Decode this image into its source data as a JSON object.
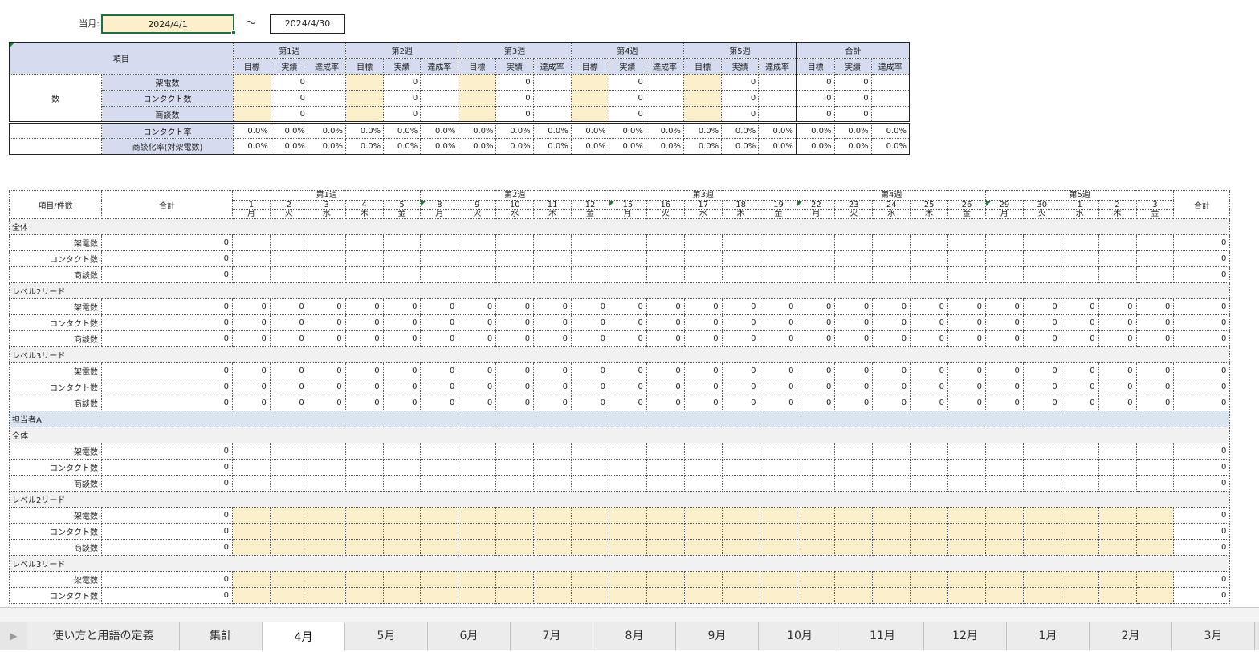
{
  "header": {
    "month_label": "当月:",
    "start_date": "2024/4/1",
    "tilde": "〜",
    "end_date": "2024/4/30"
  },
  "summary": {
    "item_header": "項目",
    "week_labels": [
      "第1週",
      "第2週",
      "第3週",
      "第4週",
      "第5週",
      "合計"
    ],
    "sub_labels": [
      "目標",
      "実績",
      "達成率"
    ],
    "group_label": "数",
    "rows": [
      {
        "label": "架電数",
        "values": [
          "",
          "0",
          "",
          "",
          "0",
          "",
          "",
          "0",
          "",
          "",
          "0",
          "",
          "",
          "0",
          "",
          "0",
          "0",
          ""
        ]
      },
      {
        "label": "コンタクト数",
        "values": [
          "",
          "0",
          "",
          "",
          "0",
          "",
          "",
          "0",
          "",
          "",
          "0",
          "",
          "",
          "0",
          "",
          "0",
          "0",
          ""
        ]
      },
      {
        "label": "商談数",
        "values": [
          "",
          "0",
          "",
          "",
          "0",
          "",
          "",
          "0",
          "",
          "",
          "0",
          "",
          "",
          "0",
          "",
          "0",
          "0",
          ""
        ]
      }
    ],
    "rate_rows": [
      {
        "label": "コンタクト率",
        "values": [
          "0.0%",
          "0.0%",
          "0.0%",
          "0.0%",
          "0.0%",
          "0.0%",
          "0.0%",
          "0.0%",
          "0.0%",
          "0.0%",
          "0.0%",
          "0.0%",
          "0.0%",
          "0.0%",
          "0.0%",
          "0.0%",
          "0.0%",
          "0.0%"
        ]
      },
      {
        "label": "商談化率(対架電数)",
        "values": [
          "0.0%",
          "0.0%",
          "0.0%",
          "0.0%",
          "0.0%",
          "0.0%",
          "0.0%",
          "0.0%",
          "0.0%",
          "0.0%",
          "0.0%",
          "0.0%",
          "0.0%",
          "0.0%",
          "0.0%",
          "0.0%",
          "0.0%",
          "0.0%"
        ]
      }
    ]
  },
  "daily": {
    "item_header": "項目/件数",
    "total_header": "合計",
    "week_labels": [
      "第1週",
      "第2週",
      "第3週",
      "第4週",
      "第5週"
    ],
    "days": [
      "1",
      "2",
      "3",
      "4",
      "5",
      "8",
      "9",
      "10",
      "11",
      "12",
      "15",
      "16",
      "17",
      "18",
      "19",
      "22",
      "23",
      "24",
      "25",
      "26",
      "29",
      "30",
      "1",
      "2",
      "3"
    ],
    "weekdays": [
      "月",
      "火",
      "水",
      "木",
      "金",
      "月",
      "火",
      "水",
      "木",
      "金",
      "月",
      "火",
      "水",
      "木",
      "金",
      "月",
      "火",
      "水",
      "木",
      "金",
      "月",
      "火",
      "水",
      "木",
      "金"
    ],
    "sections": [
      {
        "type": "section",
        "label": "全体"
      },
      {
        "type": "row",
        "label": "架電数",
        "total": "0",
        "fill": "",
        "end": "0"
      },
      {
        "type": "row",
        "label": "コンタクト数",
        "total": "0",
        "fill": "",
        "end": "0"
      },
      {
        "type": "row",
        "label": "商談数",
        "total": "0",
        "fill": "",
        "end": "0"
      },
      {
        "type": "section",
        "label": "レベル2リード"
      },
      {
        "type": "row",
        "label": "架電数",
        "total": "0",
        "fill": "0",
        "end": "0"
      },
      {
        "type": "row",
        "label": "コンタクト数",
        "total": "0",
        "fill": "0",
        "end": "0"
      },
      {
        "type": "row",
        "label": "商談数",
        "total": "0",
        "fill": "0",
        "end": "0"
      },
      {
        "type": "section",
        "label": "レベル3リード"
      },
      {
        "type": "row",
        "label": "架電数",
        "total": "0",
        "fill": "0",
        "end": "0"
      },
      {
        "type": "row",
        "label": "コンタクト数",
        "total": "0",
        "fill": "0",
        "end": "0"
      },
      {
        "type": "row",
        "label": "商談数",
        "total": "0",
        "fill": "0",
        "end": "0"
      },
      {
        "type": "group",
        "label": "担当者A"
      },
      {
        "type": "section",
        "label": "全体"
      },
      {
        "type": "row",
        "label": "架電数",
        "total": "0",
        "fill": "",
        "end": "0"
      },
      {
        "type": "row",
        "label": "コンタクト数",
        "total": "0",
        "fill": "",
        "end": "0"
      },
      {
        "type": "row",
        "label": "商談数",
        "total": "0",
        "fill": "",
        "end": "0"
      },
      {
        "type": "section",
        "label": "レベル2リード"
      },
      {
        "type": "row",
        "label": "架電数",
        "total": "0",
        "fill": "",
        "end": "0",
        "input": true
      },
      {
        "type": "row",
        "label": "コンタクト数",
        "total": "0",
        "fill": "",
        "end": "0",
        "input": true
      },
      {
        "type": "row",
        "label": "商談数",
        "total": "0",
        "fill": "",
        "end": "0",
        "input": true
      },
      {
        "type": "section",
        "label": "レベル3リード"
      },
      {
        "type": "row",
        "label": "架電数",
        "total": "0",
        "fill": "",
        "end": "0",
        "input": true
      },
      {
        "type": "row",
        "label": "コンタクト数",
        "total": "0",
        "fill": "",
        "end": "0",
        "input": true
      }
    ]
  },
  "tabs": [
    "使い方と用語の定義",
    "集計",
    "4月",
    "5月",
    "6月",
    "7月",
    "8月",
    "9月",
    "10月",
    "11月",
    "12月",
    "1月",
    "2月",
    "3月"
  ],
  "active_tab": "4月",
  "colors": {
    "input_fill": "#fcefcc",
    "header_fill": "#d6dcf0",
    "group_fill": "#dbe5f1",
    "selection_green": "#1f6f43"
  }
}
